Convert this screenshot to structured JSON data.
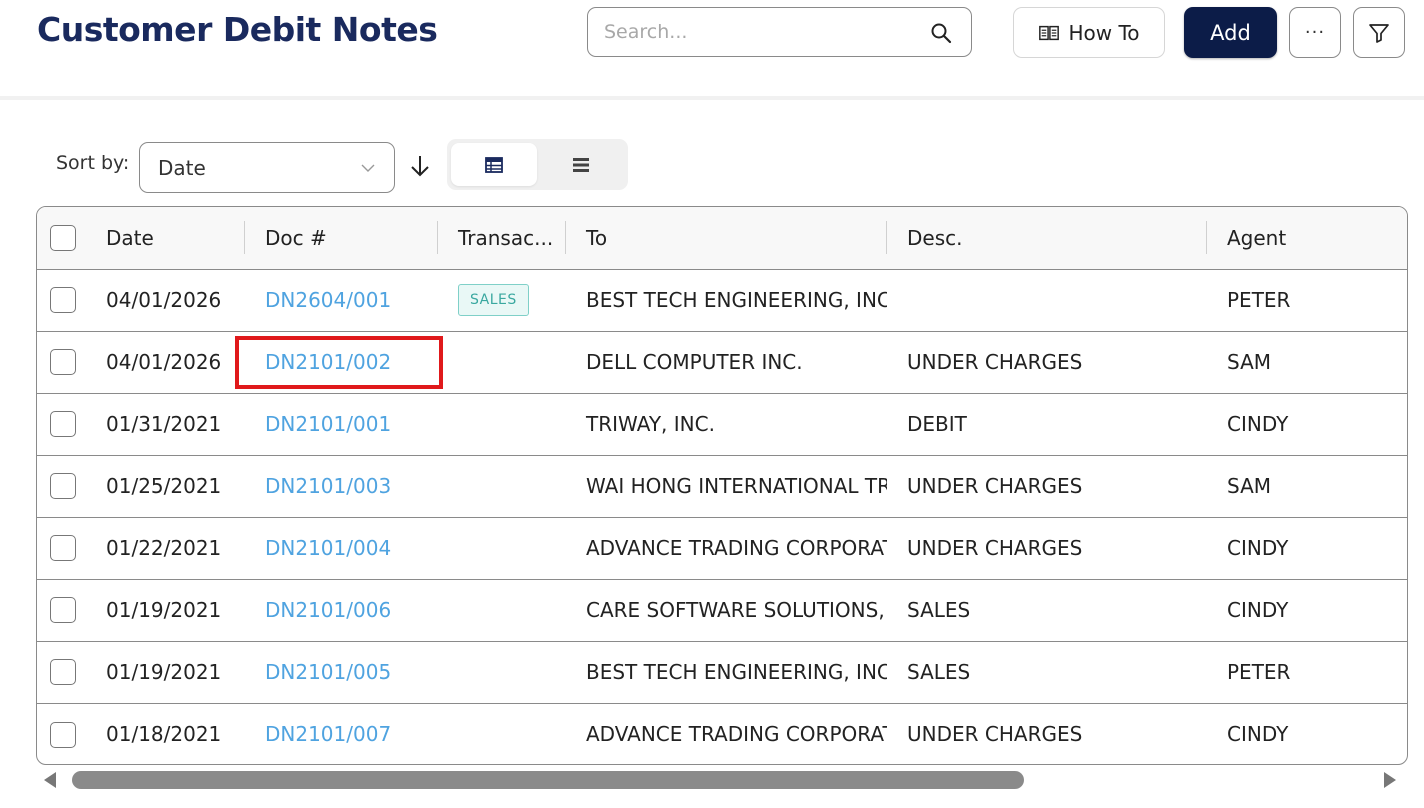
{
  "header": {
    "title": "Customer Debit Notes",
    "search_placeholder": "Search...",
    "howto_label": "How To",
    "add_label": "Add",
    "more_label": "···"
  },
  "sort": {
    "label": "Sort by:",
    "value": "Date"
  },
  "table": {
    "columns": [
      "Date",
      "Doc #",
      "Transac...",
      "To",
      "Desc.",
      "Agent"
    ],
    "rows": [
      {
        "date": "04/01/2026",
        "doc": "DN2604/001",
        "transaction": "SALES",
        "to": "BEST TECH ENGINEERING, INC.",
        "desc": "",
        "agent": "PETER"
      },
      {
        "date": "04/01/2026",
        "doc": "DN2101/002",
        "transaction": "",
        "to": "DELL COMPUTER INC.",
        "desc": "UNDER CHARGES",
        "agent": "SAM"
      },
      {
        "date": "01/31/2021",
        "doc": "DN2101/001",
        "transaction": "",
        "to": "TRIWAY, INC.",
        "desc": "DEBIT",
        "agent": "CINDY"
      },
      {
        "date": "01/25/2021",
        "doc": "DN2101/003",
        "transaction": "",
        "to": "WAI HONG INTERNATIONAL TRA",
        "desc": "UNDER CHARGES",
        "agent": "SAM"
      },
      {
        "date": "01/22/2021",
        "doc": "DN2101/004",
        "transaction": "",
        "to": "ADVANCE TRADING CORPORAT",
        "desc": "UNDER CHARGES",
        "agent": "CINDY"
      },
      {
        "date": "01/19/2021",
        "doc": "DN2101/006",
        "transaction": "",
        "to": "CARE SOFTWARE SOLUTIONS, IN",
        "desc": "SALES",
        "agent": "CINDY"
      },
      {
        "date": "01/19/2021",
        "doc": "DN2101/005",
        "transaction": "",
        "to": "BEST TECH ENGINEERING, INC.",
        "desc": "SALES",
        "agent": "PETER"
      },
      {
        "date": "01/18/2021",
        "doc": "DN2101/007",
        "transaction": "",
        "to": "ADVANCE TRADING CORPORAT",
        "desc": "UNDER CHARGES",
        "agent": "CINDY"
      }
    ]
  },
  "colors": {
    "title": "#1a2a5e",
    "primary_button": "#0c1c48",
    "link": "#4fa3e0",
    "tag_text": "#3aa8a0",
    "highlight": "#e0191b"
  },
  "icons": {
    "search": "search-icon",
    "howto": "book-icon",
    "filter": "filter-icon",
    "sort_direction": "arrow-down-icon",
    "view_table": "table-view-icon",
    "view_list": "list-view-icon"
  }
}
